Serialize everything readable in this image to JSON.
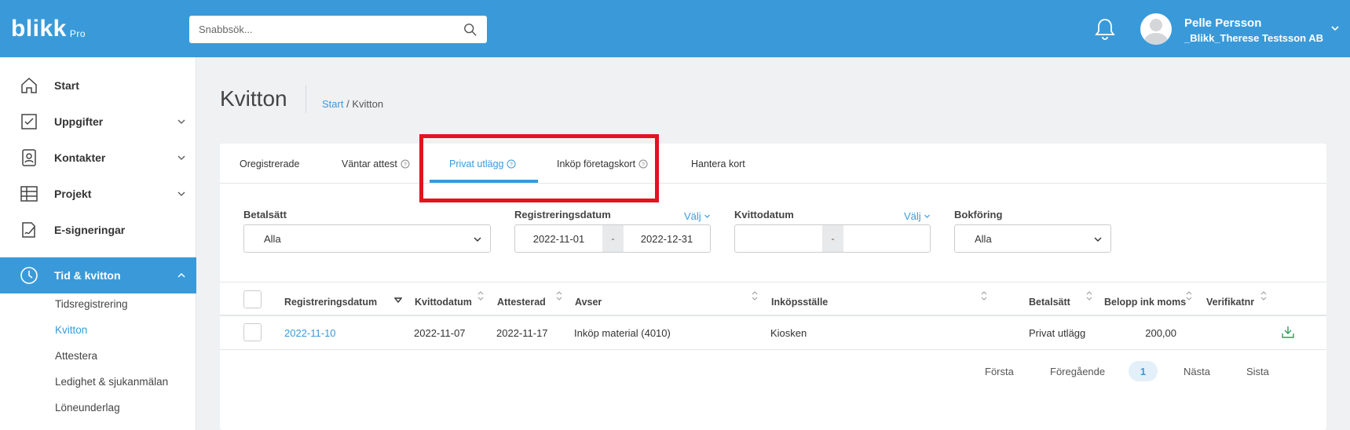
{
  "brand": {
    "name": "blikk",
    "suffix": "Pro"
  },
  "search": {
    "placeholder": "Snabbsök..."
  },
  "user": {
    "name": "Pelle Persson",
    "company": "_Blikk_Therese Testsson AB"
  },
  "sidebar": {
    "items": [
      {
        "label": "Start",
        "icon": "home-icon"
      },
      {
        "label": "Uppgifter",
        "icon": "checkbox-icon"
      },
      {
        "label": "Kontakter",
        "icon": "contact-card-icon"
      },
      {
        "label": "Projekt",
        "icon": "table-icon"
      },
      {
        "label": "E-signeringar",
        "icon": "signature-icon"
      },
      {
        "label": "Tid & kvitton",
        "icon": "clock-icon"
      }
    ],
    "subitems": [
      "Tidsregistrering",
      "Kvitton",
      "Attestera",
      "Ledighet & sjukanmälan",
      "Löneunderlag"
    ],
    "active_subitem": "Kvitton"
  },
  "page": {
    "title": "Kvitton",
    "breadcrumb_home": "Start",
    "breadcrumb_sep": " / ",
    "breadcrumb_current": "Kvitton"
  },
  "tabs": [
    {
      "label": "Oregistrerade"
    },
    {
      "label": "Väntar attest"
    },
    {
      "label": "Privat utlägg"
    },
    {
      "label": "Inköp företagskort"
    },
    {
      "label": "Hantera kort"
    }
  ],
  "active_tab": "Privat utlägg",
  "filters": {
    "betalsatt": {
      "label": "Betalsätt",
      "value": "Alla"
    },
    "registreringsdatum": {
      "label": "Registreringsdatum",
      "valj": "Välj",
      "from": "2022-11-01",
      "sep": "-",
      "to": "2022-12-31"
    },
    "kvittodatum": {
      "label": "Kvittodatum",
      "valj": "Välj",
      "from": "",
      "sep": "-",
      "to": ""
    },
    "bokforing": {
      "label": "Bokföring",
      "value": "Alla"
    }
  },
  "table": {
    "columns": [
      "Registreringsdatum",
      "Kvittodatum",
      "Attesterad",
      "Avser",
      "Inköpsställe",
      "Betalsätt",
      "Belopp ink moms",
      "Verifikatnr"
    ],
    "rows": [
      {
        "registreringsdatum": "2022-11-10",
        "kvittodatum": "2022-11-07",
        "attesterad": "2022-11-17",
        "avser": "Inköp material (4010)",
        "inkopsstalle": "Kiosken",
        "betalsatt": "Privat utlägg",
        "belopp": "200,00",
        "verifikatnr": ""
      }
    ]
  },
  "pagination": {
    "first": "Första",
    "prev": "Föregående",
    "current": "1",
    "next": "Nästa",
    "last": "Sista"
  },
  "colors": {
    "primary": "#3a9ad9",
    "highlight": "#e5121f",
    "download": "#2e9e5b"
  }
}
